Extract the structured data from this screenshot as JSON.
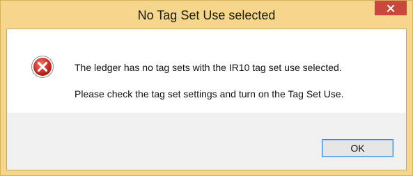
{
  "window": {
    "title": "No Tag Set Use selected",
    "frame_color": "#f5d68a",
    "close_button_color": "#c9483c"
  },
  "dialog": {
    "icon": "error-icon",
    "message_line1": "The ledger has no tag sets with the IR10 tag set use selected.",
    "message_line2": "Please check the tag set settings and turn on the Tag Set Use.",
    "ok_label": "OK"
  }
}
